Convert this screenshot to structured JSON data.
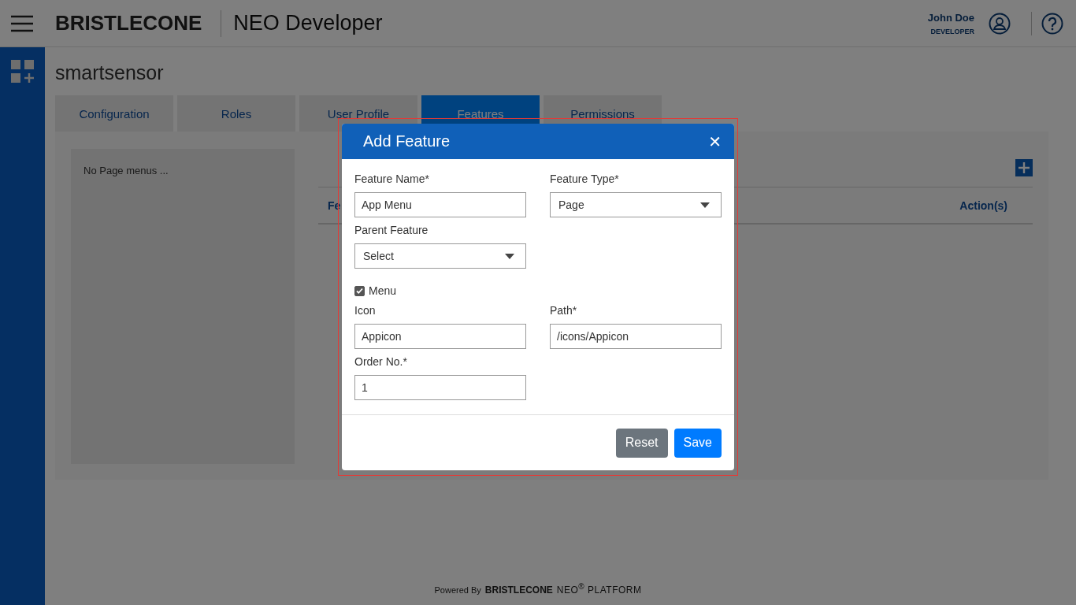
{
  "header": {
    "logo": "BRISTLECONE",
    "app_title": "NEO Developer",
    "user_name": "John Doe",
    "user_role": "DEVELOPER"
  },
  "page_title": "smartsensor",
  "tabs": [
    {
      "label": "Configuration",
      "selected": false
    },
    {
      "label": "Roles",
      "selected": false
    },
    {
      "label": "User Profile",
      "selected": false
    },
    {
      "label": "Features",
      "selected": true
    },
    {
      "label": "Permissions",
      "selected": false
    }
  ],
  "menu_panel": {
    "empty_text": "No Page menus ..."
  },
  "table": {
    "columns": [
      "Fe",
      "Action(s)"
    ]
  },
  "footer": {
    "powered_by": "Powered By",
    "brand": "BRISTLECONE",
    "product": "NEO$^{®}$ PLATFORM"
  },
  "dialog": {
    "title": "Add Feature",
    "close": "✕",
    "rows": [
      [
        {
          "kind": "text",
          "label": "Feature Name*",
          "value": "App Menu"
        },
        {
          "kind": "select",
          "label": "Feature Type*",
          "value": "Page"
        }
      ],
      [
        {
          "kind": "select",
          "label": "Parent Feature",
          "value": "Select"
        }
      ],
      [
        {
          "kind": "checkbox",
          "label": "Menu",
          "checked": true
        }
      ],
      [
        {
          "kind": "text",
          "label": "Icon",
          "value": "Appicon"
        },
        {
          "kind": "text",
          "label": "Path*",
          "value": "/icons/Appicon"
        }
      ],
      [
        {
          "kind": "text",
          "label": "Order No.*",
          "value": "1"
        }
      ]
    ],
    "buttons": [
      {
        "label": "Reset",
        "kind": "secondary"
      },
      {
        "label": "Save",
        "kind": "primary"
      }
    ]
  }
}
